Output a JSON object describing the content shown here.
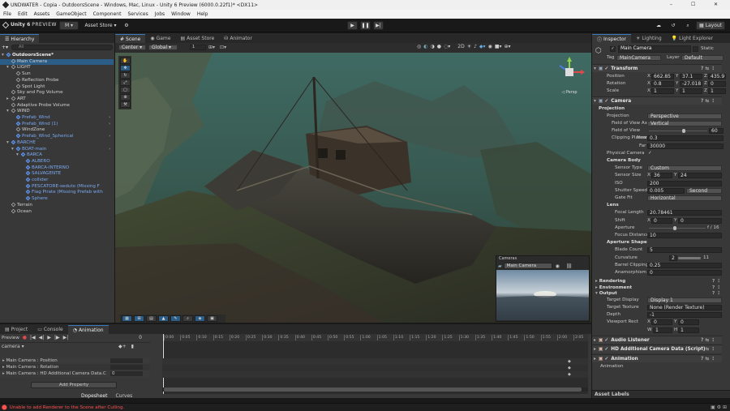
{
  "window": {
    "title": "UNDWATER - Copia - OutdoorsScene - Windows, Mac, Linux - Unity 6 Preview (6000.0.22f1)* <DX11>",
    "min": "–",
    "max": "☐",
    "close": "✕"
  },
  "menu": [
    "File",
    "Edit",
    "Assets",
    "GameObject",
    "Component",
    "Services",
    "Jobs",
    "Window",
    "Help"
  ],
  "toolbar": {
    "brand": "Unity 6",
    "brand_suffix": "PREVIEW",
    "account": "M ▾",
    "asset_store": "Asset Store ▾",
    "layout": "Layout"
  },
  "hierarchy": {
    "tab": "Hierarchy",
    "search": "All",
    "rows": [
      {
        "label": "OutdoorsScene*",
        "depth": 0,
        "arrow": "▾",
        "icon": "scene",
        "style": "scene"
      },
      {
        "label": "Main Camera",
        "depth": 1,
        "arrow": "",
        "icon": "cube",
        "style": "sel"
      },
      {
        "label": "LIGHT",
        "depth": 1,
        "arrow": "▾",
        "icon": "cube",
        "style": ""
      },
      {
        "label": "Sun",
        "depth": 2,
        "arrow": "",
        "icon": "cube",
        "style": ""
      },
      {
        "label": "Reflection Probe",
        "depth": 2,
        "arrow": "",
        "icon": "cube",
        "style": ""
      },
      {
        "label": "Spot Light",
        "depth": 2,
        "arrow": "",
        "icon": "cube",
        "style": ""
      },
      {
        "label": "Sky and Fog Volume",
        "depth": 1,
        "arrow": "",
        "icon": "cube",
        "style": ""
      },
      {
        "label": "ART",
        "depth": 1,
        "arrow": "▸",
        "icon": "cube",
        "style": ""
      },
      {
        "label": "Adaptive Probe Volume",
        "depth": 1,
        "arrow": "",
        "icon": "cube",
        "style": ""
      },
      {
        "label": "WIND",
        "depth": 1,
        "arrow": "▾",
        "icon": "cube",
        "style": ""
      },
      {
        "label": "Prefab_Wind",
        "depth": 2,
        "arrow": "",
        "icon": "cube",
        "style": "blue"
      },
      {
        "label": "Prefab_Wind (1)",
        "depth": 2,
        "arrow": "",
        "icon": "cube",
        "style": "blue"
      },
      {
        "label": "WindZone",
        "depth": 2,
        "arrow": "",
        "icon": "cube",
        "style": ""
      },
      {
        "label": "Prefab_Wind_Spherical",
        "depth": 2,
        "arrow": "",
        "icon": "cube",
        "style": "blue"
      },
      {
        "label": "BARCHE",
        "depth": 1,
        "arrow": "▾",
        "icon": "cube",
        "style": "blue"
      },
      {
        "label": "BOAT-main",
        "depth": 2,
        "arrow": "▾",
        "icon": "cube",
        "style": "blue"
      },
      {
        "label": "BARCA",
        "depth": 3,
        "arrow": "▾",
        "icon": "cube",
        "style": "blue"
      },
      {
        "label": "ALBERO",
        "depth": 4,
        "arrow": "",
        "icon": "cube",
        "style": "blue"
      },
      {
        "label": "BARCA-INTERNO",
        "depth": 4,
        "arrow": "",
        "icon": "cube",
        "style": "blue"
      },
      {
        "label": "SALVAGENTE",
        "depth": 4,
        "arrow": "",
        "icon": "cube",
        "style": "blue"
      },
      {
        "label": "collider",
        "depth": 4,
        "arrow": "",
        "icon": "cube",
        "style": "blue"
      },
      {
        "label": "PESCATORE-seduto (Missing F",
        "depth": 4,
        "arrow": "",
        "icon": "cube",
        "style": "blue"
      },
      {
        "label": "Flag Pirate (Missing Prefab with",
        "depth": 4,
        "arrow": "",
        "icon": "cube",
        "style": "blue"
      },
      {
        "label": "Sphere",
        "depth": 4,
        "arrow": "",
        "icon": "cube",
        "style": "blue"
      },
      {
        "label": "Terrain",
        "depth": 1,
        "arrow": "",
        "icon": "cube",
        "style": ""
      },
      {
        "label": "Ocean",
        "depth": 1,
        "arrow": "",
        "icon": "cube",
        "style": ""
      }
    ]
  },
  "scene_tabs": [
    {
      "label": "Scene",
      "icon": "#"
    },
    {
      "label": "Game",
      "icon": "◉"
    },
    {
      "label": "Asset Store",
      "icon": "▤"
    },
    {
      "label": "Animator",
      "icon": "⛁"
    }
  ],
  "scene_toolbar": {
    "pivot": "Center ▾",
    "space": "Global ▾",
    "snap": "1"
  },
  "gizmo": {
    "label": "◁ Persp"
  },
  "camera_overlay": {
    "title": "Cameras",
    "selected": "Main Camera"
  },
  "bottom": {
    "tabs": [
      "Project",
      "Console",
      "Animation"
    ],
    "preview": "Preview",
    "frame": "0",
    "clip": "camera",
    "tracks": [
      {
        "label": "Main Camera : Position",
        "value": ""
      },
      {
        "label": "Main Camera : Rotation",
        "value": ""
      },
      {
        "label": "Main Camera : HD Additional Camera Data.C",
        "value": "0"
      }
    ],
    "add_property": "Add Property",
    "dopesheet": "Dopesheet",
    "curves": "Curves",
    "ruler": [
      "0:00",
      "0:05",
      "0:10",
      "0:15",
      "0:20",
      "0:25",
      "0:30",
      "0:35",
      "0:40",
      "0:45",
      "0:50",
      "0:55",
      "1:00",
      "1:05",
      "1:10",
      "1:15",
      "1:20",
      "1:25",
      "1:30",
      "1:35",
      "1:40",
      "1:45",
      "1:50",
      "1:55",
      "2:00",
      "2:05"
    ]
  },
  "status": {
    "error": "Unable to add Renderer to the Scene after Culling."
  },
  "inspector": {
    "tabs": [
      "Inspector",
      "Lighting",
      "Light Explorer"
    ],
    "object_name": "Main Camera",
    "static": "Static",
    "tag_label": "Tag",
    "tag": "MainCamera",
    "layer_label": "Layer",
    "layer": "Default",
    "transform": {
      "title": "Transform",
      "rows": [
        {
          "label": "Position",
          "x": "662.85",
          "y": "37.1",
          "z": "435.9"
        },
        {
          "label": "Rotation",
          "x": "0.8",
          "y": "-27.018",
          "z": "0"
        },
        {
          "label": "Scale",
          "x": "1",
          "y": "1",
          "z": "1"
        }
      ]
    },
    "camera": {
      "title": "Camera",
      "projection_section": "Projection",
      "projection_label": "Projection",
      "projection": "Perspective",
      "fov_axis_label": "Field of View Axis",
      "fov_axis": "Vertical",
      "fov_label": "Field of View",
      "fov": "60",
      "fov_fraction": 0.6,
      "clip_label": "Clipping Planes",
      "near_label": "Near",
      "near": "0.3",
      "far_label": "Far",
      "far": "30000",
      "physical_label": "Physical Camera",
      "physical": "✓",
      "body_section": "Camera Body",
      "sensor_type_label": "Sensor Type",
      "sensor_type": "Custom",
      "sensor_size_label": "Sensor Size",
      "sensor_x": "36",
      "sensor_y": "24",
      "iso_label": "ISO",
      "iso": "200",
      "shutter_label": "Shutter Speed",
      "shutter": "0.005",
      "shutter_unit": "Second",
      "gate_label": "Gate Fit",
      "gate": "Horizontal",
      "lens_section": "Lens",
      "focal_label": "Focal Length",
      "focal": "20.78461",
      "shift_label": "Shift",
      "shift_x": "0",
      "shift_y": "0",
      "aperture_label": "Aperture",
      "aperture": "f / 16",
      "aperture_fraction": 0.45,
      "focus_label": "Focus Distance",
      "focus": "10",
      "shape_section": "Aperture Shape",
      "blade_label": "Blade Count",
      "blade": "5",
      "curv_label": "Curvature",
      "curv_min": "2",
      "curv_max": "11",
      "barrel_label": "Barrel Clipping",
      "barrel": "0.25",
      "anam_label": "Anamorphism",
      "anam": "0"
    },
    "sections": [
      "Rendering",
      "Environment",
      "Output"
    ],
    "output": {
      "display_label": "Target Display",
      "display": "Display 1",
      "texture_label": "Target Texture",
      "texture": "None (Render Texture)",
      "depth_label": "Depth",
      "depth": "-1",
      "viewport_label": "Viewport Rect",
      "vx": "0",
      "vy": "0",
      "vw": "1",
      "vh": "1"
    },
    "components": [
      "Audio Listener",
      "HD Additional Camera Data (Script)",
      "Animation"
    ],
    "animation_label": "Animation",
    "asset_labels": "Asset Labels"
  },
  "colors": {
    "accent": "#3a79bb",
    "selection": "#2c5d87",
    "prefab": "#7aa8f0",
    "error": "#ff5050"
  }
}
